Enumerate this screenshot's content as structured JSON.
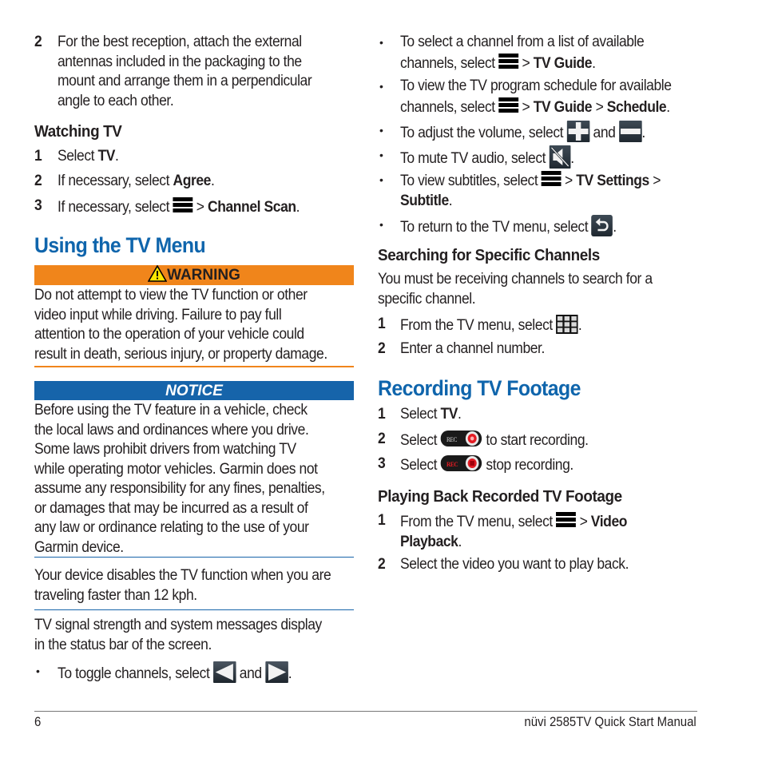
{
  "left": {
    "step2_number": "2",
    "step2_lines": [
      "For the best reception, attach the external",
      "antennas included in the packaging to the",
      "mount and arrange them in a perpendicular",
      "angle to each other."
    ],
    "watching_heading": "Watching TV",
    "watching_steps": [
      {
        "num": "1",
        "pre": "Select ",
        "bold": "TV",
        "post": "."
      },
      {
        "num": "2",
        "pre": "If necessary, select ",
        "bold": "Agree",
        "post": "."
      },
      {
        "num": "3",
        "pre": "If necessary, select ",
        "icon": "menu-icon",
        "sep": " > ",
        "bold": "Channel Scan",
        "post": "."
      }
    ],
    "section_title": "Using the TV Menu",
    "warning_label": "WARNING",
    "warning_lines": [
      "Do not attempt to view the TV function or other",
      "video input while driving. Failure to pay full",
      "attention to the operation of your vehicle could",
      "result in death, serious injury, or property damage."
    ],
    "notice_label": "NOTICE",
    "notice_lines": [
      "Before using the TV feature in a vehicle, check",
      "the local laws and ordinances where you drive.",
      "Some laws prohibit drivers from watching TV",
      "while operating motor vehicles. Garmin does not",
      "assume any responsibility for any fines, penalties,",
      "or damages that may be incurred as a result of",
      "any law or ordinance relating to the use of your",
      "Garmin device."
    ],
    "speed_lines": [
      "Your device disables the TV function when you are",
      "traveling faster than 12 kph."
    ],
    "status_lines": [
      "TV signal strength and system messages display",
      "in the status bar of the screen."
    ],
    "toggle_pre": "To toggle channels, select ",
    "toggle_and": " and ",
    "toggle_post": "."
  },
  "right": {
    "bullets": {
      "b1_l1": "To select a channel from a list of available",
      "b1_l2_pre": "channels, select ",
      "b1_sep": " > ",
      "b1_bold": "TV Guide",
      "b1_post": ".",
      "b2_l1": "To view the TV program schedule for available",
      "b2_l2_pre": "channels, select ",
      "b2_sep": " > ",
      "b2_bold1": "TV Guide",
      "b2_sep2": " > ",
      "b2_bold2": "Schedule",
      "b2_post": ".",
      "b3_pre": "To adjust the volume, select ",
      "b3_and": " and ",
      "b3_post": ".",
      "b4_pre": "To mute TV audio, select ",
      "b4_post": ".",
      "b5_pre": "To view subtitles, select ",
      "b5_sep": " > ",
      "b5_bold1": "TV Settings",
      "b5_sep2": " >",
      "b5_bold2": "Subtitle",
      "b5_post": ".",
      "b6_pre": "To return to the TV menu, select ",
      "b6_post": "."
    },
    "search_heading": "Searching for Specific Channels",
    "search_lines": [
      "You must be receiving channels to search for a",
      "specific channel."
    ],
    "search_steps": [
      {
        "num": "1",
        "pre": "From the TV menu, select ",
        "post": "."
      },
      {
        "num": "2",
        "pre": "Enter a channel number."
      }
    ],
    "record_title": "Recording TV Footage",
    "record_steps": [
      {
        "num": "1",
        "pre": "Select ",
        "bold": "TV",
        "post": "."
      },
      {
        "num": "2",
        "pre": "Select ",
        "post": " to start recording.",
        "rec_label": "REC"
      },
      {
        "num": "3",
        "pre": "Select ",
        "post": " stop recording.",
        "rec_label": "REC"
      }
    ],
    "playback_heading": "Playing Back Recorded TV Footage",
    "playback_steps": [
      {
        "num": "1",
        "pre": "From the TV menu, select ",
        "sep": " > ",
        "bold1": "Video",
        "bold2": "Playback",
        "post": "."
      },
      {
        "num": "2",
        "pre": "Select the video you want to play back."
      }
    ]
  },
  "footer": {
    "page_number": "6",
    "manual_title": "nüvi 2585TV Quick Start Manual"
  },
  "colors": {
    "heading_blue": "#0f65ac",
    "warning_orange": "#f0851b",
    "notice_blue": "#1664aa"
  }
}
